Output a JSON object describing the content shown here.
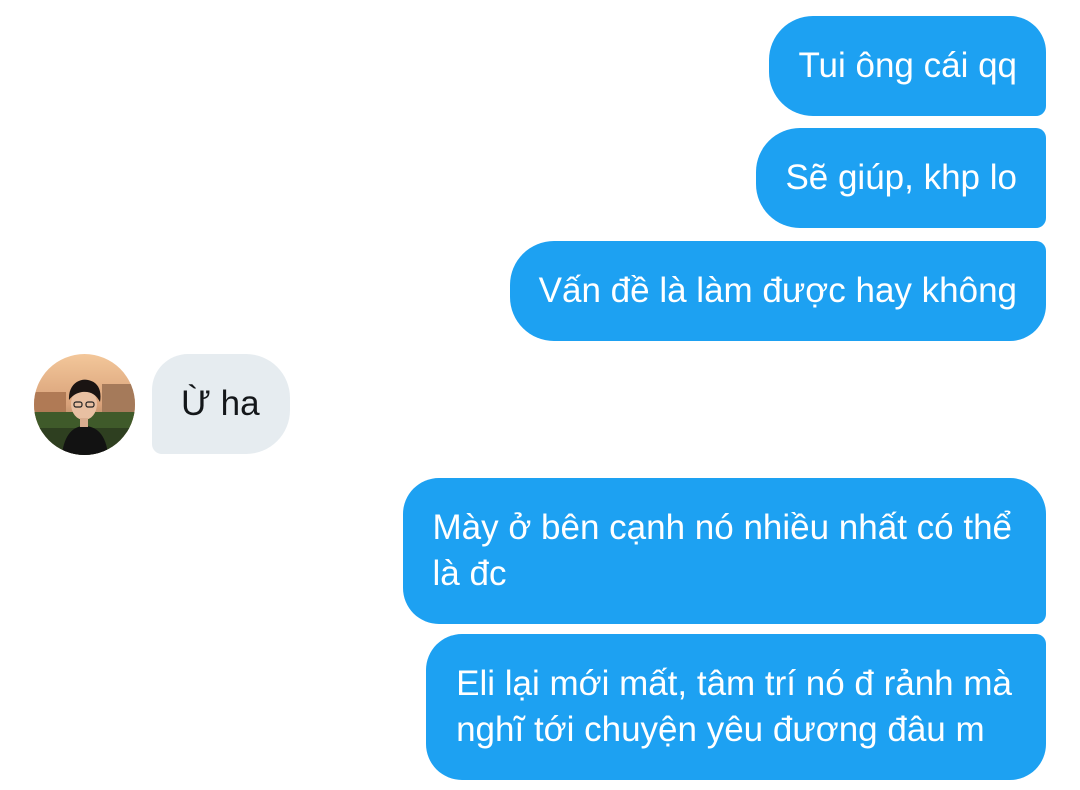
{
  "conversation": {
    "messages": [
      {
        "direction": "outgoing",
        "text": "Tui ông cái qq"
      },
      {
        "direction": "outgoing",
        "text": "Sẽ giúp, khp lo"
      },
      {
        "direction": "outgoing",
        "text": "Vấn đề là làm được hay không"
      },
      {
        "direction": "incoming",
        "text": "Ừ ha",
        "avatar_icon": "user-avatar-photo"
      },
      {
        "direction": "outgoing",
        "text": "Mày ở bên cạnh nó nhiều nhất có thể\nlà đc"
      },
      {
        "direction": "outgoing",
        "text": "Eli lại mới mất, tâm trí nó đ rảnh mà\nnghĩ tới chuyện yêu đương đâu m"
      }
    ]
  },
  "colors": {
    "outgoing_bubble": "#1DA1F2",
    "outgoing_text": "#FFFFFF",
    "incoming_bubble": "#E6ECF0",
    "incoming_text": "#14171A",
    "background": "#FFFFFF"
  }
}
